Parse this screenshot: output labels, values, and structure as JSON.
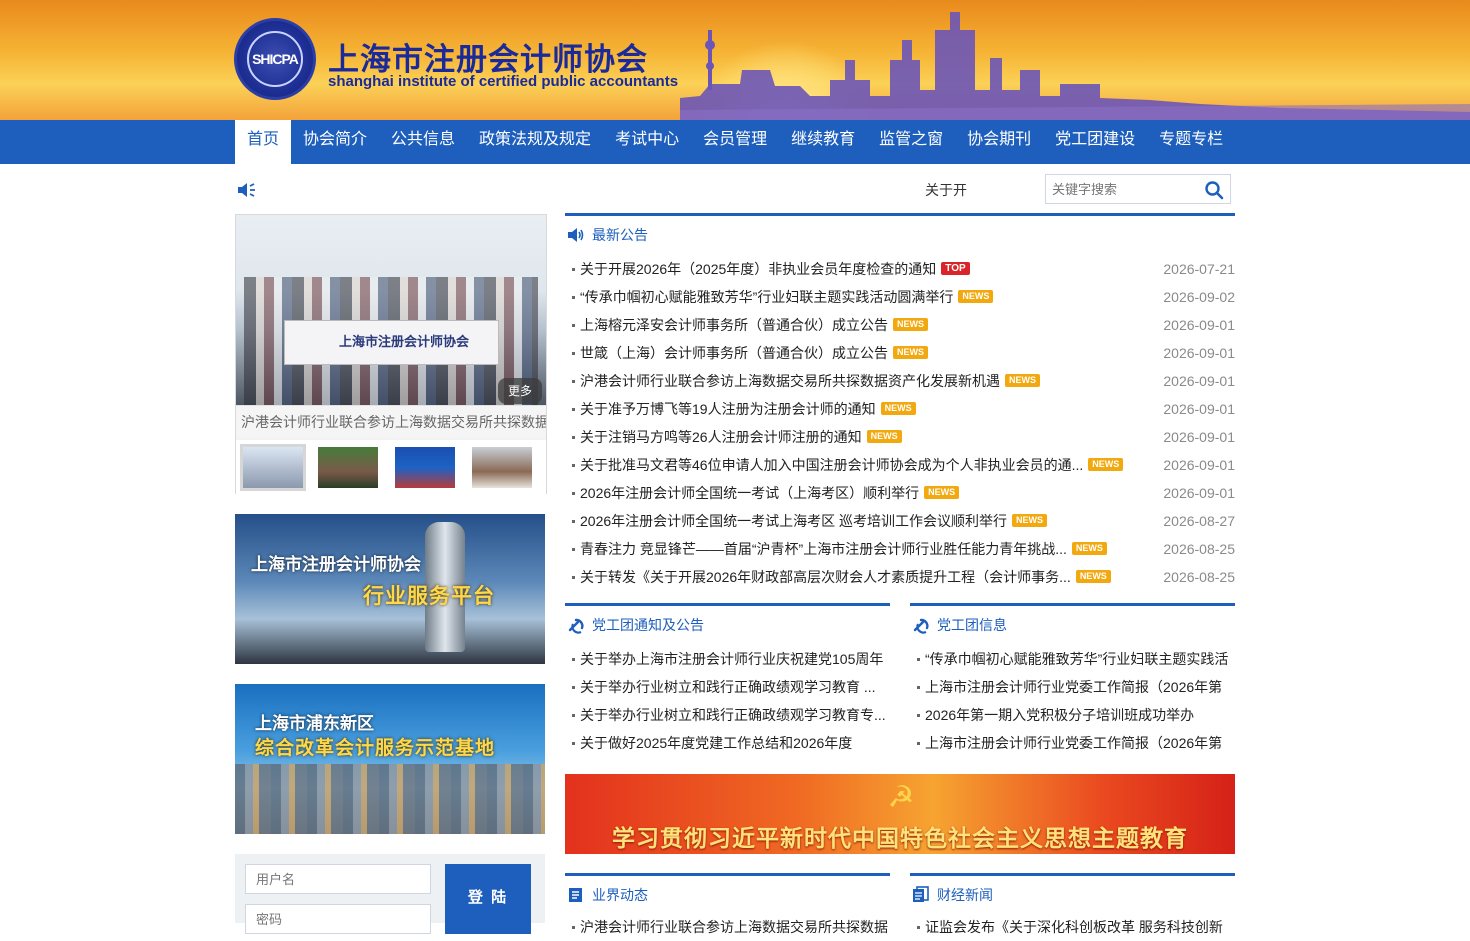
{
  "header": {
    "logo_seal_text": "SHICPA",
    "title_cn": "上海市注册会计师协会",
    "title_en": "shanghai institute of certified public accountants"
  },
  "nav": [
    {
      "label": "首页",
      "active": true
    },
    {
      "label": "协会简介"
    },
    {
      "label": "公共信息"
    },
    {
      "label": "政策法规及规定"
    },
    {
      "label": "考试中心"
    },
    {
      "label": "会员管理"
    },
    {
      "label": "继续教育"
    },
    {
      "label": "监管之窗"
    },
    {
      "label": "协会期刊"
    },
    {
      "label": "党工团建设"
    },
    {
      "label": "专题专栏"
    }
  ],
  "notice_bar": {
    "scroll_text": "关于开",
    "speaker_icon": "speaker-icon"
  },
  "search": {
    "placeholder": "关键字搜索",
    "icon": "search-icon"
  },
  "slider": {
    "banner_text": "上海市注册会计师协会",
    "more_label": "更多",
    "caption": "沪港会计师行业联合参访上海数据交易所共探数据资产化发展新机遇",
    "thumb_count": 4
  },
  "promos": [
    {
      "line1": "上海市注册会计师协会",
      "line2": "行业服务平台"
    },
    {
      "line1": "上海市浦东新区",
      "line2": "综合改革会计服务示范基地"
    }
  ],
  "login": {
    "username_placeholder": "用户名",
    "password_placeholder": "密码",
    "submit_label": "登 陆"
  },
  "notices": {
    "title": "最新公告",
    "items": [
      {
        "text": "关于开展2026年（2025年度）非执业会员年度检查的通知",
        "tag": "TOP",
        "date": "2026-07-21"
      },
      {
        "text": "“传承巾帼初心赋能雅致芳华”行业妇联主题实践活动圆满举行",
        "tag": "NEWS",
        "date": "2026-09-02"
      },
      {
        "text": "上海榕元泽安会计师事务所（普通合伙）成立公告",
        "tag": "NEWS",
        "date": "2026-09-01"
      },
      {
        "text": "世箴（上海）会计师事务所（普通合伙）成立公告",
        "tag": "NEWS",
        "date": "2026-09-01"
      },
      {
        "text": "沪港会计师行业联合参访上海数据交易所共探数据资产化发展新机遇",
        "tag": "NEWS",
        "date": "2026-09-01"
      },
      {
        "text": "关于准予万博飞等19人注册为注册会计师的通知",
        "tag": "NEWS",
        "date": "2026-09-01"
      },
      {
        "text": "关于注销马方鸣等26人注册会计师注册的通知",
        "tag": "NEWS",
        "date": "2026-09-01"
      },
      {
        "text": "关于批准马文君等46位申请人加入中国注册会计师协会成为个人非执业会员的通...",
        "tag": "NEWS",
        "date": "2026-09-01"
      },
      {
        "text": "2026年注册会计师全国统一考试（上海考区）顺利举行",
        "tag": "NEWS",
        "date": "2026-09-01"
      },
      {
        "text": "2026年注册会计师全国统一考试上海考区 巡考培训工作会议顺利举行",
        "tag": "NEWS",
        "date": "2026-08-27"
      },
      {
        "text": "青春注力 竞显锋芒——首届“沪青杯”上海市注册会计师行业胜任能力青年挑战...",
        "tag": "NEWS",
        "date": "2026-08-25"
      },
      {
        "text": "关于转发《关于开展2026年财政部高层次财会人才素质提升工程（会计师事务...",
        "tag": "NEWS",
        "date": "2026-08-25"
      }
    ]
  },
  "party_notices": {
    "title": "党工团通知及公告",
    "items": [
      "关于举办上海市注册会计师行业庆祝建党105周年",
      "关于举办行业树立和践行正确政绩观学习教育 ...",
      "关于举办行业树立和践行正确政绩观学习教育专...",
      "关于做好2025年度党建工作总结和2026年度"
    ]
  },
  "party_info": {
    "title": "党工团信息",
    "items": [
      "“传承巾帼初心赋能雅致芳华”行业妇联主题实践活",
      "上海市注册会计师行业党委工作简报（2026年第",
      "2026年第一期入党积极分子培训班成功举办",
      "上海市注册会计师行业党委工作简报（2026年第"
    ]
  },
  "party_banner": {
    "emblem": "☭",
    "text": "学习贯彻习近平新时代中国特色社会主义思想主题教育"
  },
  "industry": {
    "title": "业界动态",
    "items": [
      "沪港会计师行业联合参访上海数据交易所共探数据"
    ]
  },
  "finance": {
    "title": "财经新闻",
    "items": [
      "证监会发布《关于深化科创板改革 服务科技创新"
    ]
  },
  "colors": {
    "brand_blue": "#1e5fbd",
    "top_tag": "#d9252a",
    "news_tag": "#f2a80f"
  }
}
